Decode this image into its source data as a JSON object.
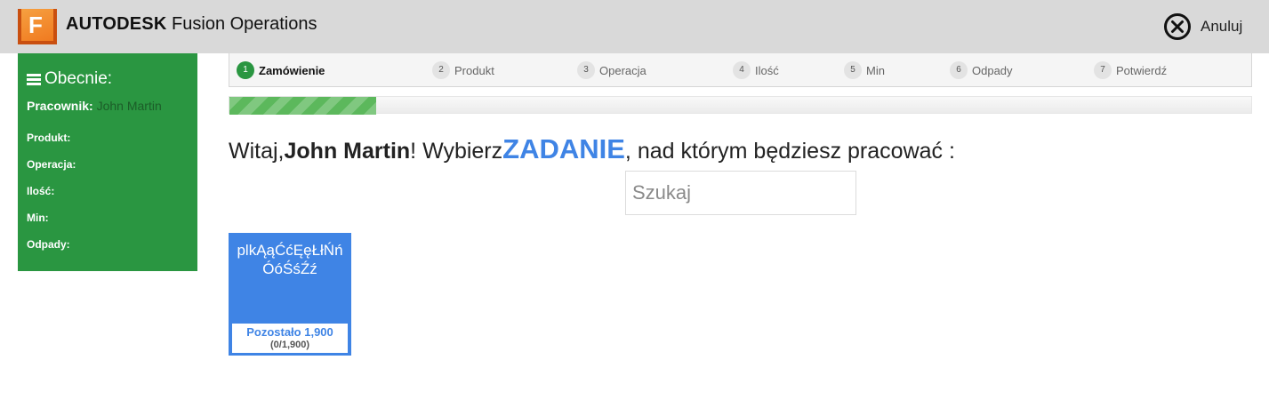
{
  "header": {
    "logo_letter": "F",
    "brand_bold": "AUTODESK",
    "brand_rest": "Fusion Operations",
    "cancel_label": "Anuluj",
    "cancel_icon": "circle-x-icon"
  },
  "sidebar": {
    "title": "Obecnie:",
    "title_icon": "hamburger-icon",
    "worker_label": "Pracownik",
    "worker_value": "John Martin",
    "fields": [
      "Produkt:",
      "Operacja:",
      "Ilość:",
      "Min:",
      "Odpady:"
    ]
  },
  "steps": [
    {
      "num": "1",
      "label": "Zamówienie",
      "active": true
    },
    {
      "num": "2",
      "label": "Produkt",
      "active": false
    },
    {
      "num": "3",
      "label": "Operacja",
      "active": false
    },
    {
      "num": "4",
      "label": "Ilość",
      "active": false
    },
    {
      "num": "5",
      "label": "Min",
      "active": false
    },
    {
      "num": "6",
      "label": "Odpady",
      "active": false
    },
    {
      "num": "7",
      "label": "Potwierdź",
      "active": false
    }
  ],
  "progress": {
    "fraction": 0.1433
  },
  "welcome": {
    "prefix": "Witaj,",
    "name": "John Martin",
    "middle": "! Wybierz",
    "task_word": "ZADANIE",
    "suffix": ", nad którym będziesz pracować :"
  },
  "search": {
    "placeholder": "Szukaj",
    "value": ""
  },
  "tasks": [
    {
      "title": "plkĄąĆćĘęŁłŃńÓóŚśŹź",
      "remaining": "Pozostało 1,900",
      "count": "(0/1,900)"
    }
  ],
  "colors": {
    "header_bg": "#d9d9d9",
    "sidebar_bg": "#2a9641",
    "accent_blue": "#3f84e5",
    "progress_green": "#5cb85c",
    "logo_orange": "#f07a20"
  }
}
